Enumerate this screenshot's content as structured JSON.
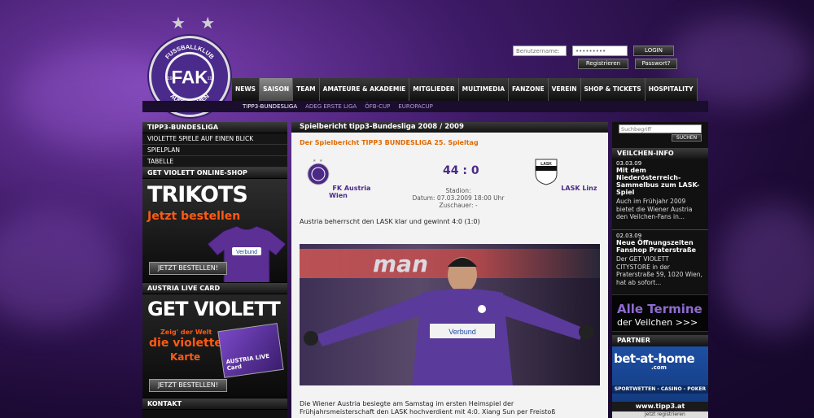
{
  "header": {
    "logo_text_top": "FUSSBALLKLUB",
    "logo_text_bottom": "AUSTRIA WIEN",
    "logo_letters": "FAK",
    "logo_year_left": "19",
    "logo_year_right": "11",
    "stars": "★ ★"
  },
  "login": {
    "username_placeholder": "Benutzername:",
    "password_value": "•••••••••",
    "login_label": "LOGIN",
    "register_label": "Registrieren",
    "forgot_label": "Passwort?"
  },
  "nav": {
    "items": [
      "NEWS",
      "SAISON",
      "TEAM",
      "AMATEURE & AKADEMIE",
      "MITGLIEDER",
      "MULTIMEDIA",
      "FANZONE",
      "VEREIN",
      "SHOP & TICKETS",
      "HOSPITALITY"
    ],
    "active_index": 1,
    "sub": [
      "TIPP3-BUNDESLIGA",
      "ADEG ERSTE LIGA",
      "ÖFB-CUP",
      "EUROPACUP"
    ],
    "sub_active_index": 0
  },
  "left": {
    "section1_title": "TIPP3-BUNDESLIGA",
    "section1_items": [
      "VIOLETTE SPIELE AUF EINEN BLICK",
      "SPIELPLAN",
      "TABELLE"
    ],
    "section2_title": "GET VIOLETT ONLINE-SHOP",
    "promo1_big": "TRIKOTS",
    "promo1_orange": "Jetzt bestellen",
    "promo1_button": "JETZT BESTELLEN!",
    "promo1_shirt_sponsor": "Verbund",
    "section3_title": "AUSTRIA LIVE CARD",
    "promo2_big": "GET VIOLETT",
    "promo2_line1": "Zeig' der Welt",
    "promo2_line2": "die violette",
    "promo2_line3": "Karte",
    "promo2_button": "JETZT BESTELLEN!",
    "promo2_card_text": "AUSTRIA LIVE Card",
    "section4_title": "KONTAKT"
  },
  "report": {
    "title": "Spielbericht tipp3-Bundesliga 2008 / 2009",
    "subtitle": "Der Spielbericht TIPP3 BUNDESLIGA 25. Spieltag",
    "home": "FK Austria Wien",
    "away": "LASK Linz",
    "away_crest_text": "LASK",
    "score": "44 : 0",
    "stadium": "Stadion:",
    "date": "Datum: 07.03.2009 18:00 Uhr",
    "spectators": "Zuschauer: -",
    "lead": "Austria beherrscht den LASK klar und gewinnt 4:0 (1:0)",
    "body1": "Die Wiener Austria besiegte am Samstag im ersten Heimspiel der",
    "body2": "Frühjahrsmeisterschaft den LASK hochverdient mit 4:0. Xiang Sun per Freistoß",
    "photo_sponsor": "Verbund",
    "photo_banner_text": "man"
  },
  "right": {
    "search_placeholder": "Suchbegriff",
    "search_button": "SUCHEN",
    "news_title": "VEILCHEN-INFO",
    "news": [
      {
        "date": "03.03.09",
        "head": "Mit dem Niederösterreich-Sammelbus zum LASK-Spiel",
        "text": "Auch im Frühjahr 2009 bietet die Wiener Austria den Veilchen-Fans in..."
      },
      {
        "date": "02.03.09",
        "head": "Neue Öffnungszeiten Fanshop Praterstraße",
        "text": "Der GET VIOLETT CITYSTORE in der Praterstraße 59, 1020 Wien, hat ab sofort..."
      }
    ],
    "termine_l1": "Alle Termine",
    "termine_l2": "der Veilchen  >>>",
    "partner_title": "PARTNER",
    "partner_brand": "bet-at-home",
    "partner_brand_sub": ".com",
    "partner_tag": "SPORTWETTEN - CASINO - POKER",
    "partner2": "www.tipp3.at",
    "partner2_teaser": "Jetzt registrieren"
  },
  "colors": {
    "violet": "#4b2a87",
    "orange": "#e06a00",
    "bg_dark": "#111111"
  }
}
